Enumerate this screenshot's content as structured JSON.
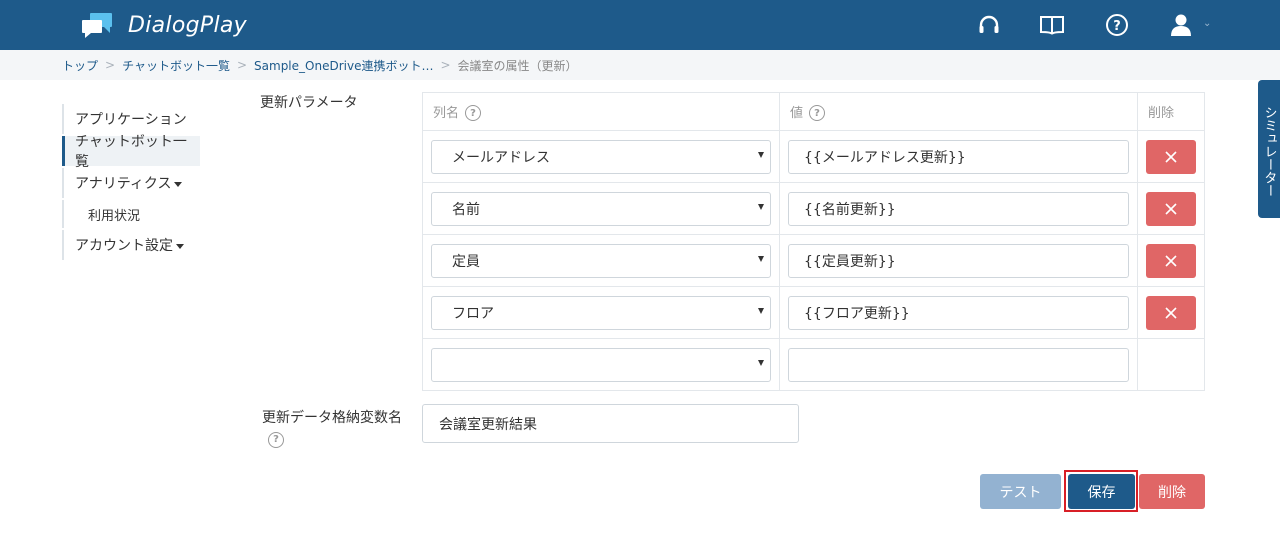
{
  "header": {
    "app_name": "DialogPlay",
    "icons": [
      "support-headset-icon",
      "book-icon",
      "help-icon",
      "user-icon"
    ]
  },
  "breadcrumb": {
    "items": [
      "トップ",
      "チャットボット一覧",
      "Sample_OneDrive連携ボット…"
    ],
    "current": "会議室の属性（更新）"
  },
  "sidebar": {
    "items": [
      {
        "label": "アプリケーション"
      },
      {
        "label": "チャットボット一覧"
      },
      {
        "label": "アナリティクス"
      },
      {
        "label": "利用状況"
      },
      {
        "label": "アカウント設定"
      }
    ]
  },
  "form": {
    "params_label": "更新パラメータ",
    "col_name_header": "列名",
    "col_value_header": "値",
    "col_delete_header": "削除",
    "rows": [
      {
        "column": "メールアドレス",
        "value": "{{メールアドレス更新}}"
      },
      {
        "column": "名前",
        "value": "{{名前更新}}"
      },
      {
        "column": "定員",
        "value": "{{定員更新}}"
      },
      {
        "column": "フロア",
        "value": "{{フロア更新}}"
      },
      {
        "column": "",
        "value": ""
      }
    ],
    "var_label": "更新データ格納変数名",
    "var_value": "会議室更新結果"
  },
  "buttons": {
    "test": "テスト",
    "save": "保存",
    "delete": "削除"
  },
  "simulator_tab": "シミュレーター",
  "colors": {
    "header_bg": "#1e5a8a",
    "danger": "#e06666",
    "test_button": "#93b2d1",
    "highlight_border": "#d81f26"
  }
}
